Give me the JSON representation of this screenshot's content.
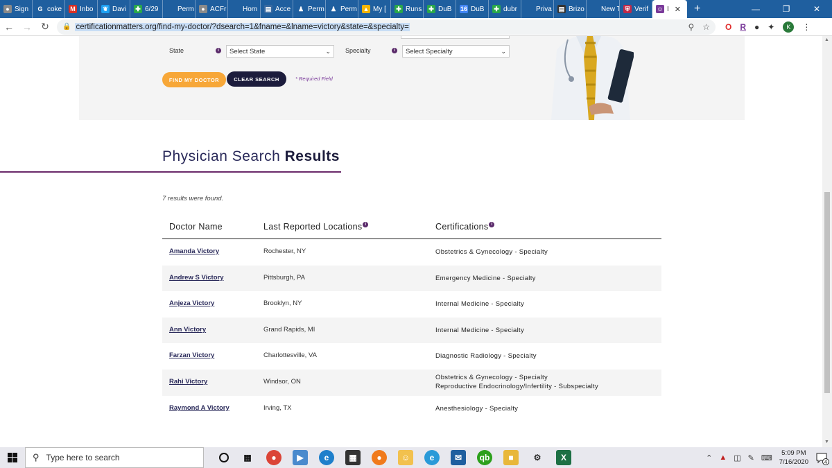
{
  "browser": {
    "tabs": [
      {
        "label": "Sign",
        "icon": "globe-icon",
        "color": "#8a8a8a"
      },
      {
        "label": "coke",
        "icon": "google-icon",
        "color": "#1f5f9f"
      },
      {
        "label": "Inbo",
        "icon": "gmail-icon",
        "color": "#d93025"
      },
      {
        "label": "Davi",
        "icon": "twitter-icon",
        "color": "#1da1f2"
      },
      {
        "label": "6/29",
        "icon": "cross-icon",
        "color": "#2aa84a"
      },
      {
        "label": "Perm",
        "icon": "blank-icon",
        "color": "#1f5f9f"
      },
      {
        "label": "ACFr",
        "icon": "globe-icon",
        "color": "#8a8a8a"
      },
      {
        "label": "Hom",
        "icon": "blank-icon",
        "color": "#1f5f9f"
      },
      {
        "label": "Acce",
        "icon": "page-icon",
        "color": "#3a6aa0"
      },
      {
        "label": "Perm",
        "icon": "person-icon",
        "color": "#1f5f9f"
      },
      {
        "label": "Perm",
        "icon": "person-icon",
        "color": "#1f5f9f"
      },
      {
        "label": "My [",
        "icon": "drive-icon",
        "color": "#f4b400"
      },
      {
        "label": "Runs",
        "icon": "cross-icon",
        "color": "#2aa84a"
      },
      {
        "label": "DuB",
        "icon": "cross-icon",
        "color": "#2aa84a"
      },
      {
        "label": "DuB",
        "icon": "calendar-icon",
        "color": "#4285f4"
      },
      {
        "label": "dubr",
        "icon": "cross-icon",
        "color": "#2aa84a"
      },
      {
        "label": "Priva",
        "icon": "blank-icon",
        "color": "#1f5f9f"
      },
      {
        "label": "Brizo",
        "icon": "page-icon",
        "color": "#333333"
      },
      {
        "label": "New Tab",
        "icon": "blank-icon",
        "color": "#1f5f9f"
      },
      {
        "label": "Verif",
        "icon": "shield-icon",
        "color": "#c02a4a"
      },
      {
        "label": "I",
        "icon": "doctor-icon",
        "color": "#7a3a9a",
        "active": true
      }
    ],
    "new_tab": "+",
    "url": "certificationmatters.org/find-my-doctor/?dsearch=1&fname=&lname=victory&state=&specialty=",
    "extensions": [
      "O",
      "R",
      "K"
    ]
  },
  "search_form": {
    "state_label": "State",
    "state_value": "Select State",
    "specialty_label": "Specialty",
    "specialty_value": "Select Specialty",
    "find_button": "FIND MY DOCTOR",
    "clear_button": "CLEAR SEARCH",
    "required_note": "* Required Field"
  },
  "results": {
    "title_light": "Physician Search ",
    "title_bold": "Results",
    "count_text": "7 results were found.",
    "columns": [
      "Doctor Name",
      "Last Reported Locations",
      "Certifications"
    ],
    "rows": [
      {
        "name": "Amanda Victory",
        "location": "Rochester, NY",
        "certs": [
          "Obstetrics & Gynecology - Specialty"
        ]
      },
      {
        "name": "Andrew S Victory",
        "location": "Pittsburgh, PA",
        "certs": [
          "Emergency Medicine - Specialty"
        ]
      },
      {
        "name": "Anjeza Victory",
        "location": "Brooklyn, NY",
        "certs": [
          "Internal Medicine - Specialty"
        ]
      },
      {
        "name": "Ann Victory",
        "location": "Grand Rapids, MI",
        "certs": [
          "Internal Medicine - Specialty"
        ]
      },
      {
        "name": "Farzan Victory",
        "location": "Charlottesville, VA",
        "certs": [
          "Diagnostic Radiology - Specialty"
        ]
      },
      {
        "name": "Rahi Victory",
        "location": "Windsor, ON",
        "certs": [
          "Obstetrics & Gynecology - Specialty",
          "Reproductive Endocrinology/Infertility - Subspecialty"
        ]
      },
      {
        "name": "Raymond A Victory",
        "location": "Irving, TX",
        "certs": [
          "Anesthesiology - Specialty"
        ]
      }
    ]
  },
  "taskbar": {
    "search_placeholder": "Type here to search",
    "time": "5:09 PM",
    "date": "7/16/2020",
    "notification_count": "4"
  }
}
